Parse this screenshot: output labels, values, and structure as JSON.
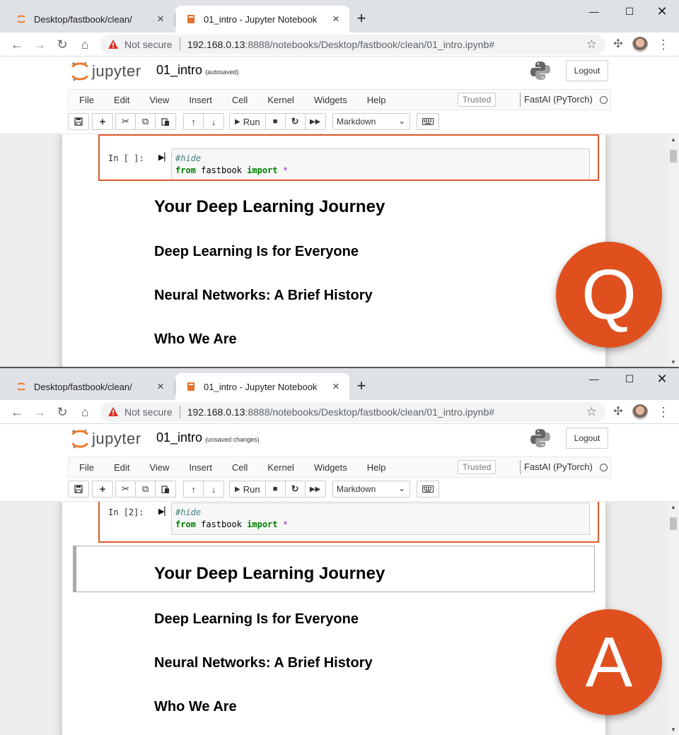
{
  "panels": [
    {
      "id": "question",
      "tabs": [
        {
          "title": "Desktop/fastbook/clean/",
          "active": false
        },
        {
          "title": "01_intro - Jupyter Notebook",
          "active": true
        }
      ],
      "address_bar": {
        "security_label": "Not secure",
        "url_host": "192.168.0.13",
        "url_path": ":8888/notebooks/Desktop/fastbook/clean/01_intro.ipynb#"
      },
      "jupyter": {
        "logo_text": "jupyter",
        "notebook_name": "01_intro",
        "save_status": "(autosaved)",
        "logout_label": "Logout",
        "menu": [
          "File",
          "Edit",
          "View",
          "Insert",
          "Cell",
          "Kernel",
          "Widgets",
          "Help"
        ],
        "trusted_label": "Trusted",
        "kernel_name": "FastAI (PyTorch)",
        "run_label": "Run",
        "cell_type": "Markdown"
      },
      "cell": {
        "prompt": "In [ ]:",
        "line1": "#hide",
        "line2_kw1": "from",
        "line2_mod": " fastbook ",
        "line2_kw2": "import",
        "line2_op": " *"
      },
      "headings": {
        "h1": "Your Deep Learning Journey",
        "h2a": "Deep Learning Is for Everyone",
        "h2b": "Neural Networks: A Brief History",
        "h2c": "Who We Are"
      },
      "badge": "Q"
    },
    {
      "id": "answer",
      "tabs": [
        {
          "title": "Desktop/fastbook/clean/",
          "active": false
        },
        {
          "title": "01_intro - Jupyter Notebook",
          "active": true
        }
      ],
      "address_bar": {
        "security_label": "Not secure",
        "url_host": "192.168.0.13",
        "url_path": ":8888/notebooks/Desktop/fastbook/clean/01_intro.ipynb#"
      },
      "jupyter": {
        "logo_text": "jupyter",
        "notebook_name": "01_intro",
        "save_status": "(unsaved changes)",
        "logout_label": "Logout",
        "menu": [
          "File",
          "Edit",
          "View",
          "Insert",
          "Cell",
          "Kernel",
          "Widgets",
          "Help"
        ],
        "trusted_label": "Trusted",
        "kernel_name": "FastAI (PyTorch)",
        "run_label": "Run",
        "cell_type": "Markdown"
      },
      "cell": {
        "prompt": "In [2]:",
        "line1": "#hide",
        "line2_kw1": "from",
        "line2_mod": " fastbook ",
        "line2_kw2": "import",
        "line2_op": " *"
      },
      "headings": {
        "h1": "Your Deep Learning Journey",
        "h2a": "Deep Learning Is for Everyone",
        "h2b": "Neural Networks: A Brief History",
        "h2c": "Who We Are"
      },
      "badge": "A"
    }
  ],
  "colors": {
    "highlight": "#e05a2b",
    "badge": "#e0501f",
    "jupyter_orange": "#f37626"
  }
}
